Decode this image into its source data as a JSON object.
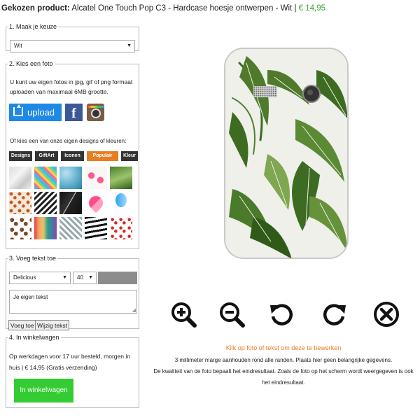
{
  "header": {
    "label": "Gekozen product:",
    "product": "Alcatel One Touch Pop C3 - Hardcase hoesje ontwerpen - Wit |",
    "price": "€ 14,95"
  },
  "step1": {
    "legend": "1. Maak je keuze",
    "select_value": "Wit"
  },
  "step2": {
    "legend": "2. Kies een foto",
    "intro_line1": "U kunt uw eigen fotos in jpg, gif of png formaat",
    "intro_line2": "uploaden van maximaal 6MB grootte.",
    "upload_label": "upload",
    "facebook_letter": "f",
    "designs_intro": "Of kies een van onze eigen designs of kleuren:",
    "tabs": [
      "Designs",
      "GiftArt",
      "Iconen",
      "Populair",
      "Kleur"
    ],
    "active_tab": "Populair"
  },
  "step3": {
    "legend": "3. Voeg tekst toe",
    "font_value": "Delicious",
    "size_value": "40",
    "text_placeholder": "Je eigen tekst",
    "add_label": "Voeg toe",
    "edit_label": "Wijzig tekst"
  },
  "step4": {
    "legend": "4. In winkelwagen",
    "line1": "Op werkdagen voor 17 uur besteld, morgen in",
    "line2": "huis | € 14,95 (Gratis verzending)",
    "cart_label": "In winkelwagen"
  },
  "controls": [
    "zoom-in",
    "zoom-out",
    "rotate-left",
    "rotate-right",
    "remove"
  ],
  "info": {
    "click_hint": "Klik op foto of tekst om deze te bewerken",
    "line1": "3 millimeter marge aanhouden rond alle randen. Plaats hier geen belangrijke gegevens.",
    "line2": "De kwaliteit van de foto bepaalt het eindresultaat. Zoals de foto op het scherm wordt weergegeven is ook",
    "line3": "het eindresultaat."
  },
  "colors": {
    "price": "#3fa535",
    "accent": "#e67e22",
    "upload": "#1e88e5",
    "cart": "#33cc33"
  }
}
